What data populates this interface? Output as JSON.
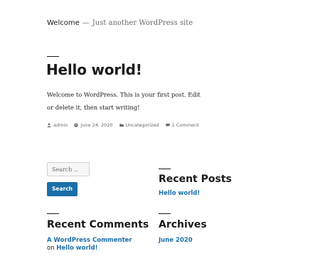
{
  "header": {
    "site_title": "Welcome",
    "separator": "—",
    "description": "Just another WordPress site"
  },
  "post": {
    "title": "Hello world!",
    "body": "Welcome to WordPress. This is your first post. Edit or delete it, then start writing!",
    "meta": {
      "author": "admin",
      "date": "June 24, 2020",
      "category": "Uncategorized",
      "comments": "1 Comment"
    }
  },
  "search": {
    "placeholder": "Search …",
    "button_label": "Search"
  },
  "widgets": {
    "recent_posts": {
      "title": "Recent Posts",
      "items": [
        "Hello world!"
      ]
    },
    "recent_comments": {
      "title": "Recent Comments",
      "items": [
        {
          "author": "A WordPress Commenter",
          "on": "on",
          "post": "Hello world!"
        }
      ]
    },
    "archives": {
      "title": "Archives",
      "items": [
        "June 2020"
      ]
    }
  },
  "colors": {
    "link": "#1a6fa8",
    "text": "#1a1a1a",
    "muted": "#686868"
  },
  "icons": {
    "author": "user-icon",
    "date": "clock-icon",
    "category": "folder-icon",
    "comments": "comment-icon"
  }
}
